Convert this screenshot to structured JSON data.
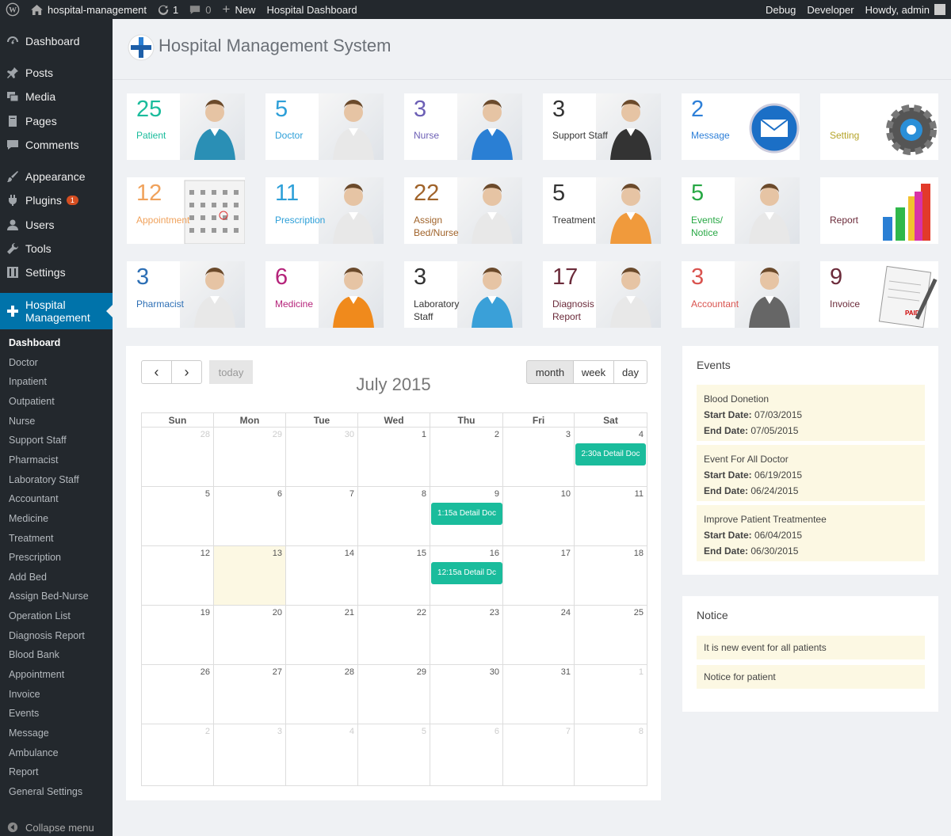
{
  "adminbar": {
    "site": "hospital-management",
    "updates": "1",
    "comments": "0",
    "new": "New",
    "page": "Hospital Dashboard",
    "debug": "Debug",
    "developer": "Developer",
    "howdy": "Howdy, admin"
  },
  "menu": [
    {
      "label": "Dashboard",
      "icon": "dashboard-icon"
    },
    {
      "label": "Posts",
      "icon": "pin-icon"
    },
    {
      "label": "Media",
      "icon": "media-icon"
    },
    {
      "label": "Pages",
      "icon": "pages-icon"
    },
    {
      "label": "Comments",
      "icon": "comment-icon"
    },
    {
      "label": "Appearance",
      "icon": "brush-icon"
    },
    {
      "label": "Plugins",
      "icon": "plugin-icon",
      "badge": "1"
    },
    {
      "label": "Users",
      "icon": "user-icon"
    },
    {
      "label": "Tools",
      "icon": "wrench-icon"
    },
    {
      "label": "Settings",
      "icon": "settings-icon"
    },
    {
      "label": "Hospital\nManagement",
      "icon": "plus-icon"
    }
  ],
  "submenu": [
    "Dashboard",
    "Doctor",
    "Inpatient",
    "Outpatient",
    "Nurse",
    "Support Staff",
    "Pharmacist",
    "Laboratory Staff",
    "Accountant",
    "Medicine",
    "Treatment",
    "Prescription",
    "Add Bed",
    "Assign Bed-Nurse",
    "Operation List",
    "Diagnosis Report",
    "Blood Bank",
    "Appointment",
    "Invoice",
    "Events",
    "Message",
    "Ambulance",
    "Report",
    "General Settings"
  ],
  "collapse": "Collapse menu",
  "title": "Hospital Management System",
  "tiles": [
    {
      "num": "25",
      "label": "Patient",
      "color": "#1abc9c",
      "pic": "patient-image"
    },
    {
      "num": "5",
      "label": "Doctor",
      "color": "#2d9fd8",
      "pic": "doctor-image"
    },
    {
      "num": "3",
      "label": "Nurse",
      "color": "#6c5fb5",
      "pic": "nurse-image"
    },
    {
      "num": "3",
      "label": "Support Staff",
      "color": "#333333",
      "pic": "support-staff-image"
    },
    {
      "num": "2",
      "label": "Message",
      "color": "#2d7fd8",
      "pic": "envelope-image"
    },
    {
      "num": "",
      "label": "Setting",
      "color": "#b5a42a",
      "pic": "gear-image"
    },
    {
      "num": "12",
      "label": "Appointment",
      "color": "#f0a25c",
      "pic": "calendar-image"
    },
    {
      "num": "11",
      "label": "Prescription",
      "color": "#2d9fd8",
      "pic": "prescription-image"
    },
    {
      "num": "22",
      "label": "Assign\nBed/Nurse",
      "color": "#a0632a",
      "pic": "bed-image"
    },
    {
      "num": "5",
      "label": "Treatment",
      "color": "#333333",
      "pic": "treatment-image"
    },
    {
      "num": "5",
      "label": "Events/\nNotice",
      "color": "#27a844",
      "pic": "events-image"
    },
    {
      "num": "",
      "label": "Report",
      "color": "#6b2b3a",
      "pic": "report-chart-image"
    },
    {
      "num": "3",
      "label": "Pharmacist",
      "color": "#2d6fb5",
      "pic": "pharmacist-image"
    },
    {
      "num": "6",
      "label": "Medicine",
      "color": "#b5237a",
      "pic": "medicine-image"
    },
    {
      "num": "3",
      "label": "Laboratory\nStaff",
      "color": "#333333",
      "pic": "lab-staff-image"
    },
    {
      "num": "17",
      "label": "Diagnosis\nReport",
      "color": "#6b2b3a",
      "pic": "diagnosis-image"
    },
    {
      "num": "3",
      "label": "Accountant",
      "color": "#d9534f",
      "pic": "accountant-image"
    },
    {
      "num": "9",
      "label": "Invoice",
      "color": "#6b2b3a",
      "pic": "invoice-image"
    }
  ],
  "calendar": {
    "title": "July 2015",
    "today": "today",
    "prev": "‹",
    "next": "›",
    "views": [
      "month",
      "week",
      "day"
    ],
    "days": [
      "Sun",
      "Mon",
      "Tue",
      "Wed",
      "Thu",
      "Fri",
      "Sat"
    ],
    "weeks": [
      [
        "28",
        "29",
        "30",
        "1",
        "2",
        "3",
        "4"
      ],
      [
        "5",
        "6",
        "7",
        "8",
        "9",
        "10",
        "11"
      ],
      [
        "12",
        "13",
        "14",
        "15",
        "16",
        "17",
        "18"
      ],
      [
        "19",
        "20",
        "21",
        "22",
        "23",
        "24",
        "25"
      ],
      [
        "26",
        "27",
        "28",
        "29",
        "30",
        "31",
        "1"
      ],
      [
        "2",
        "3",
        "4",
        "5",
        "6",
        "7",
        "8"
      ]
    ],
    "events": [
      {
        "week": 0,
        "day": 6,
        "text": "2:30a Detail Doc"
      },
      {
        "week": 1,
        "day": 4,
        "text": "1:15a Detail Doc"
      },
      {
        "week": 2,
        "day": 4,
        "text": "12:15a Detail Dc"
      }
    ]
  },
  "events_panel": {
    "title": "Events",
    "start_label": "Start Date:",
    "end_label": "End Date:",
    "items": [
      {
        "name": "Blood Donetion",
        "start": "07/03/2015",
        "end": "07/05/2015"
      },
      {
        "name": "Event For All Doctor",
        "start": "06/19/2015",
        "end": "06/24/2015"
      },
      {
        "name": "Improve Patient Treatmentee",
        "start": "06/04/2015",
        "end": "06/30/2015"
      }
    ]
  },
  "notice_panel": {
    "title": "Notice",
    "items": [
      "It is new event for all patients",
      "Notice for patient"
    ]
  }
}
